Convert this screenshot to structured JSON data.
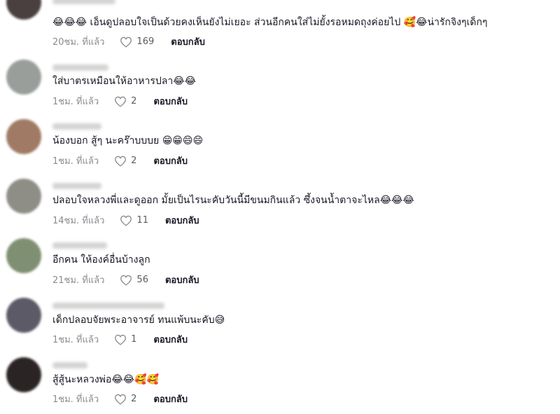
{
  "comments": [
    {
      "text": "เอ็นดูปลอบใจเป็นด้วยคงเห็นยังไม่เยอะ ส่วนอีกคนใส่ไม่ยั้งรอหมดถุงค่อยไป",
      "emoji_before": "😂😂😂",
      "emoji_after": "🥰😂",
      "tail": "น่ารักจิงๆเด็กๆ",
      "time": "20ชม. ที่แล้ว",
      "likes": "169",
      "reply": "ตอบกลับ",
      "avatar_color": "#4a4040"
    },
    {
      "text": "ใส่บาตรเหมือนให้อาหารปลา",
      "emoji_before": "",
      "emoji_after": "😂😂",
      "tail": "",
      "time": "1ชม. ที่แล้ว",
      "likes": "2",
      "reply": "ตอบกลับ",
      "avatar_color": "#9a9e9a"
    },
    {
      "text": "น้องบอก สู้ๆ นะคร๊าบบบย",
      "emoji_before": "",
      "emoji_after": "😁😁😄😄",
      "tail": "",
      "time": "1ชม. ที่แล้ว",
      "likes": "2",
      "reply": "ตอบกลับ",
      "avatar_color": "#a07a64"
    },
    {
      "text": "ปลอบใจหลวงพี่และดูออก มั้ยเป็นไรนะคับวันนี้มีขนมกินแล้ว ซึ้งจนน้ำตาจะไหล",
      "emoji_before": "",
      "emoji_after": "😂😂😂",
      "tail": "",
      "time": "14ชม. ที่แล้ว",
      "likes": "11",
      "reply": "ตอบกลับ",
      "avatar_color": "#8e8e86"
    },
    {
      "text": "อีกคน ให้องค์อื่นบ้างลูก",
      "emoji_before": "",
      "emoji_after": "",
      "tail": "",
      "time": "21ชม. ที่แล้ว",
      "likes": "56",
      "reply": "ตอบกลับ",
      "avatar_color": "#7f8f72"
    },
    {
      "text": "เด็กปลอบจัยพระอาจารย์ ทนแพ้บนะคับ",
      "emoji_before": "",
      "emoji_after": "😅",
      "tail": "",
      "time": "1ชม. ที่แล้ว",
      "likes": "1",
      "reply": "ตอบกลับ",
      "avatar_color": "#5c5a66"
    },
    {
      "text": "สู้สู้นะหลวงพ่อ",
      "emoji_before": "",
      "emoji_after": "😂😂🥰🥰",
      "tail": "",
      "time": "1ชม. ที่แล้ว",
      "likes": "2",
      "reply": "ตอบกลับ",
      "avatar_color": "#2a2424"
    }
  ],
  "icons": {
    "like": "heart-outline-icon"
  },
  "colors": {
    "meta": "#8a8b91",
    "reply": "#161823"
  }
}
